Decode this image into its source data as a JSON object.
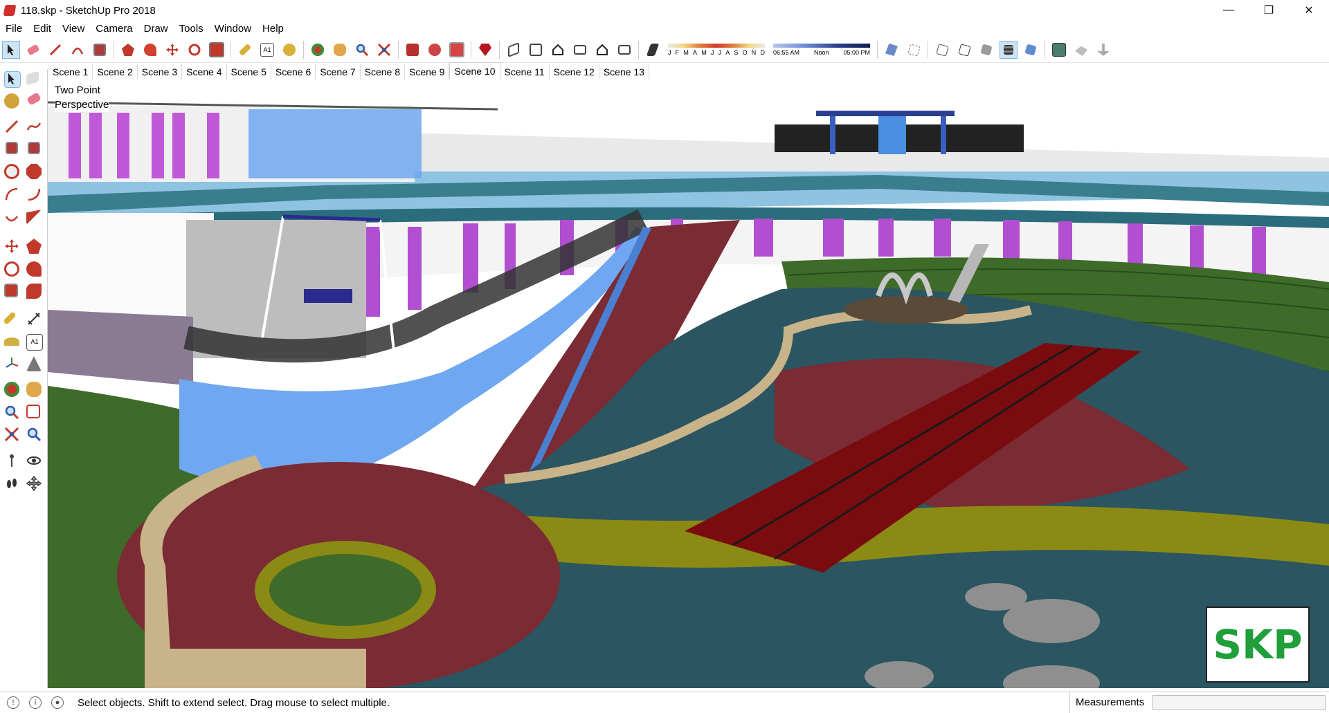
{
  "window": {
    "title": "118.skp - SketchUp Pro 2018",
    "controls": {
      "minimize": "—",
      "maximize": "❐",
      "close": "✕"
    }
  },
  "menu": [
    "File",
    "Edit",
    "View",
    "Camera",
    "Draw",
    "Tools",
    "Window",
    "Help"
  ],
  "toolbar": {
    "icons": [
      "select-icon",
      "eraser-icon",
      "line-icon",
      "arc-icon",
      "rectangle-icon",
      "push-pull-icon",
      "follow-me-icon",
      "move-icon",
      "rotate-icon",
      "scale-icon",
      "tape-measure-icon",
      "text-icon",
      "paint-bucket-icon",
      "orbit-icon",
      "pan-icon",
      "zoom-icon",
      "zoom-extents-icon",
      "warehouse-icon",
      "extension-icon",
      "layout-icon",
      "ruby-icon"
    ],
    "views": [
      "iso-view-icon",
      "top-view-icon",
      "front-view-icon",
      "right-view-icon",
      "back-view-icon",
      "left-view-icon"
    ],
    "shadow_months": [
      "J",
      "F",
      "M",
      "A",
      "M",
      "J",
      "J",
      "A",
      "S",
      "O",
      "N",
      "D"
    ],
    "shadow_time_start": "06:55 AM",
    "shadow_time_mid": "Noon",
    "shadow_time_end": "05:00 PM",
    "styles": [
      "xray-icon",
      "back-edges-icon",
      "wireframe-icon",
      "hidden-line-icon",
      "shaded-icon",
      "shaded-textures-icon",
      "monochrome-icon"
    ],
    "extra": [
      "map-icon",
      "sandbox-icon",
      "terrain-icon"
    ]
  },
  "scenes": [
    "Scene 1",
    "Scene 2",
    "Scene 3",
    "Scene 4",
    "Scene 5",
    "Scene 6",
    "Scene 7",
    "Scene 8",
    "Scene 9",
    "Scene 10",
    "Scene 11",
    "Scene 12",
    "Scene 13"
  ],
  "active_scene": "Scene 10",
  "viewport": {
    "camera_line1": "Two Point",
    "camera_line2": "Perspective",
    "logo": "SKP"
  },
  "status": {
    "message": "Select objects. Shift to extend select. Drag mouse to select multiple.",
    "measurements_label": "Measurements",
    "measurements_value": ""
  },
  "colors": {
    "grass": "#3f6b2a",
    "path_teal": "#2b5560",
    "track_red": "#7a2b34",
    "yellow_band": "#8a8a14",
    "water_blue": "#6fa8f0",
    "purple_panel": "#c158d8"
  }
}
